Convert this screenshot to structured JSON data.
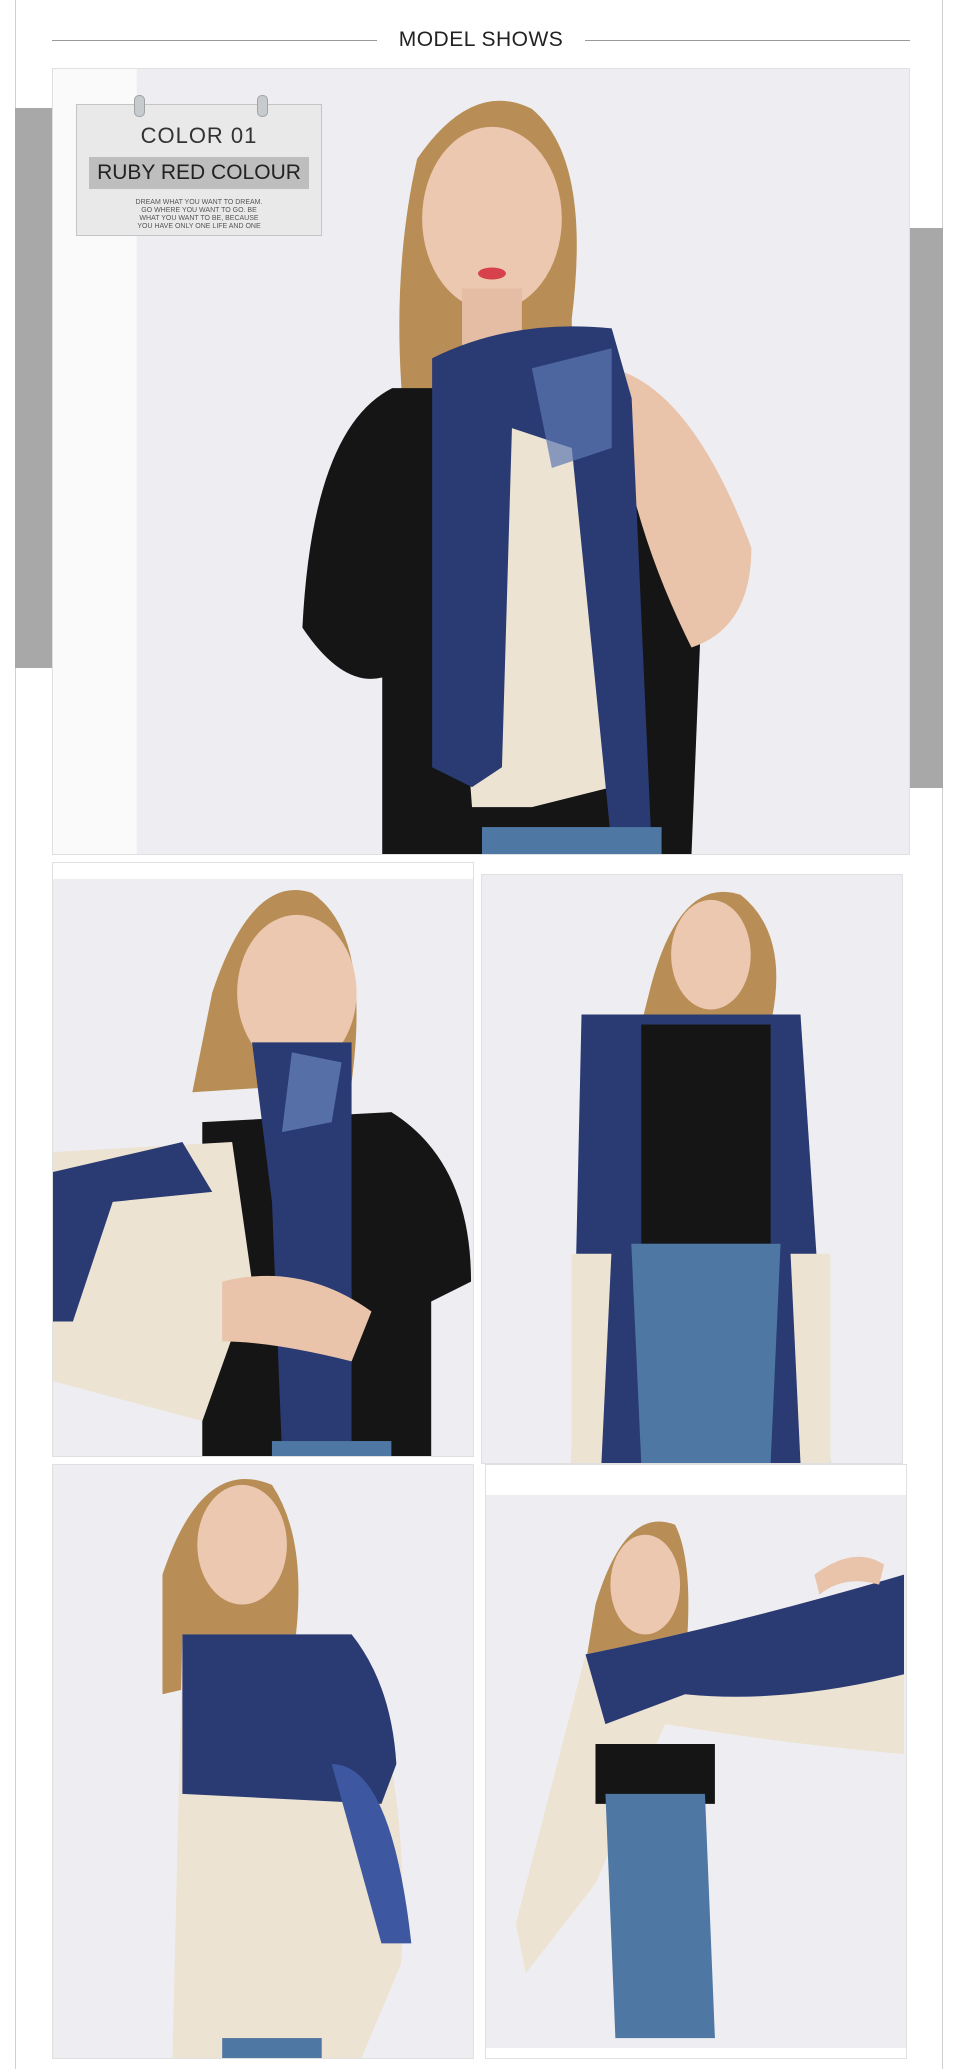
{
  "header": {
    "title": "MODEL SHOWS"
  },
  "tag": {
    "color_no": "COLOR 01",
    "color_name": "RUBY RED COLOUR",
    "slogan": [
      "DREAM WHAT YOU WANT TO DREAM.",
      "GO WHERE YOU WANT TO GO. BE",
      "WHAT YOU WANT TO BE, BECAUSE",
      "YOU HAVE ONLY ONE LIFE AND ONE"
    ]
  },
  "colors": {
    "navy": "#2a3a72",
    "cream": "#ede3d3",
    "shirt": "#151515",
    "skin": "#e9c3aa",
    "hair": "#b88e56",
    "denim": "#4e77a4",
    "backdrop": "#eeeef2"
  }
}
